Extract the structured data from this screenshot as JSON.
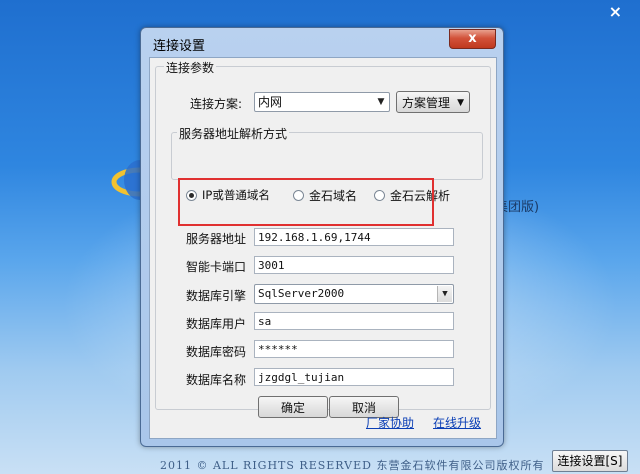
{
  "background": {
    "close_glyph": "×",
    "partial_title": "集团版)",
    "footer": "2011 © ALL RIGHTS RESERVED 东营金石软件有限公司版权所有",
    "settings_button": "连接设置[S]"
  },
  "dialog": {
    "title": "连接设置",
    "close_glyph": "x",
    "group_connection": "连接参数",
    "scheme_label": "连接方案:",
    "scheme_value": "内网",
    "scheme_manage_button": "方案管理",
    "group_resolve": "服务器地址解析方式",
    "resolve_options": [
      {
        "label": "IP或普通域名",
        "selected": true
      },
      {
        "label": "金石域名",
        "selected": false
      },
      {
        "label": "金石云解析",
        "selected": false
      }
    ],
    "fields": {
      "server_address_label": "服务器地址",
      "server_address_value": "192.168.1.69,1744",
      "smartcard_port_label": "智能卡端口",
      "smartcard_port_value": "3001",
      "db_engine_label": "数据库引擎",
      "db_engine_value": "SqlServer2000",
      "db_user_label": "数据库用户",
      "db_user_value": "sa",
      "db_password_label": "数据库密码",
      "db_password_value": "******",
      "db_name_label": "数据库名称",
      "db_name_value": "jzgdgl_tujian"
    },
    "ok_button": "确定",
    "cancel_button": "取消",
    "vendor_link": "厂家协助",
    "upgrade_link": "在线升级"
  },
  "colors": {
    "highlight_box": "#e03030",
    "link": "#0a3eb5"
  }
}
